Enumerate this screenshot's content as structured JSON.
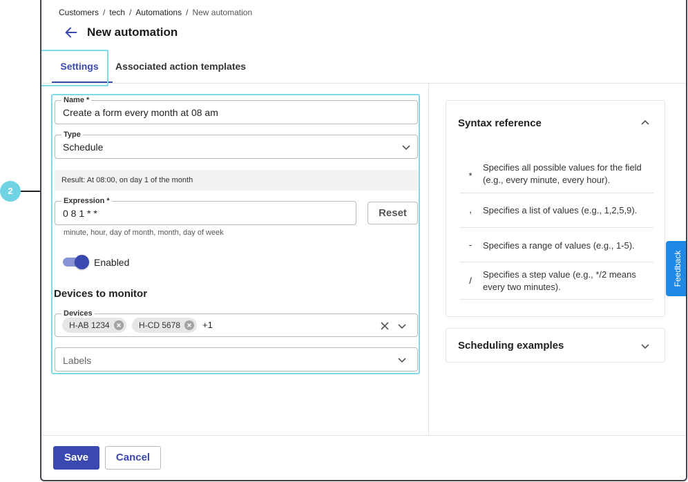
{
  "breadcrumb": {
    "items": [
      "Customers",
      "tech",
      "Automations"
    ],
    "current": "New automation",
    "separator": "/"
  },
  "page": {
    "title": "New automation"
  },
  "tabs": [
    {
      "label": "Settings",
      "active": true
    },
    {
      "label": "Associated action templates",
      "active": false
    }
  ],
  "form": {
    "name": {
      "label": "Name *",
      "value": "Create a form every month at 08 am"
    },
    "type": {
      "label": "Type",
      "value": "Schedule"
    },
    "result": {
      "label": "Result:",
      "value": "At 08:00, on day 1 of the month"
    },
    "expression": {
      "label": "Expression *",
      "value": "0 8 1 * *",
      "hint": "minute, hour, day of month, month, day of week",
      "reset_label": "Reset"
    },
    "enabled": {
      "label": "Enabled",
      "on": true
    },
    "devices_section_title": "Devices to monitor",
    "devices": {
      "label": "Devices",
      "chips": [
        "H-AB 1234",
        "H-CD 5678"
      ],
      "more": "+1"
    },
    "labels": {
      "placeholder": "Labels"
    }
  },
  "syntax_reference": {
    "title": "Syntax reference",
    "expanded": true,
    "rows": [
      {
        "symbol": "*",
        "description": "Specifies all possible values for the field (e.g., every minute, every hour)."
      },
      {
        "symbol": ",",
        "description": "Specifies a list of values (e.g., 1,2,5,9)."
      },
      {
        "symbol": "-",
        "description": "Specifies a range of values (e.g., 1-5)."
      },
      {
        "symbol": "/",
        "description": "Specifies a step value (e.g., */2 means every two minutes)."
      }
    ]
  },
  "scheduling_examples": {
    "title": "Scheduling examples",
    "expanded": false
  },
  "feedback": {
    "label": "Feedback"
  },
  "footer": {
    "save_label": "Save",
    "cancel_label": "Cancel"
  },
  "callout": {
    "number": "2"
  },
  "colors": {
    "primary": "#3a49b0",
    "highlight": "#7fd9e6",
    "feedback": "#1e88e5",
    "callout": "#6fd3e3"
  }
}
